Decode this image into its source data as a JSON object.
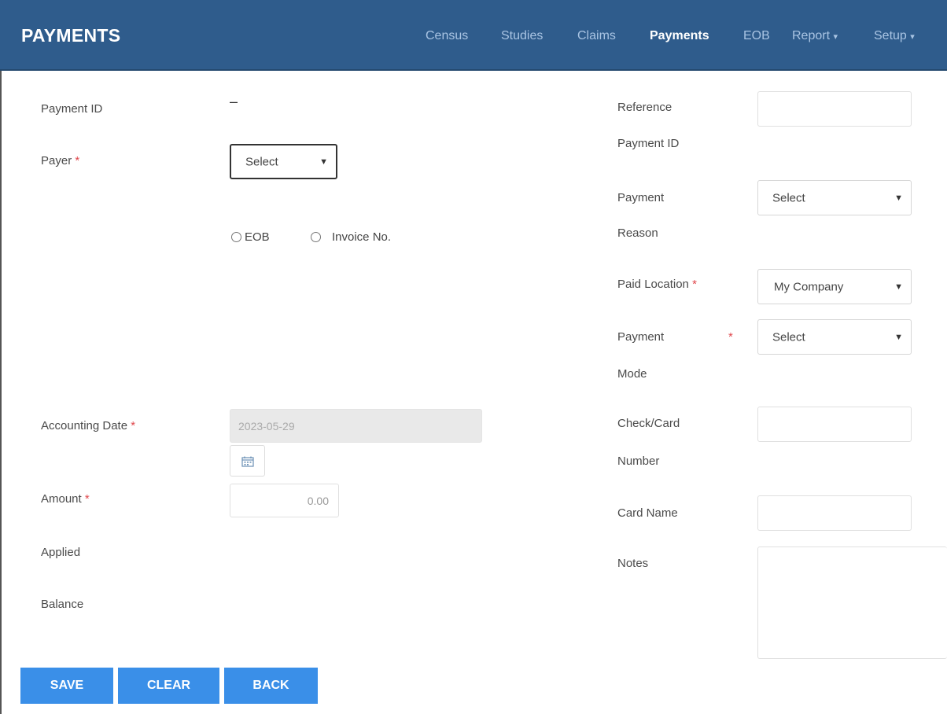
{
  "header": {
    "title": "PAYMENTS",
    "nav": [
      {
        "label": "Census",
        "active": false
      },
      {
        "label": "Studies",
        "active": false
      },
      {
        "label": "Claims",
        "active": false
      },
      {
        "label": "Payments",
        "active": true
      },
      {
        "label": "EOB",
        "active": false
      },
      {
        "label": "Report",
        "active": false,
        "dropdown": "▾"
      },
      {
        "label": "Setup",
        "active": false,
        "dropdown": "▾"
      }
    ]
  },
  "left": {
    "payment_id": {
      "label": "Payment ID",
      "value": "–"
    },
    "payer": {
      "label": "Payer",
      "required": "*",
      "selected": "Select"
    },
    "radios": {
      "eob": "EOB",
      "invoice": "Invoice No."
    },
    "accounting_date": {
      "label": "Accounting Date",
      "required": "*",
      "value": "2023-05-29"
    },
    "amount": {
      "label": "Amount",
      "required": "*",
      "value": "0.00"
    },
    "applied": {
      "label": "Applied"
    },
    "balance": {
      "label": "Balance"
    }
  },
  "right": {
    "reference": {
      "label_line1": "Reference",
      "label_line2": "Payment ID",
      "value": ""
    },
    "reason": {
      "label_line1": "Payment",
      "label_line2": "Reason",
      "selected": "Select"
    },
    "location": {
      "label": "Paid Location",
      "required": "*",
      "selected": "My Company"
    },
    "mode": {
      "label_line1": "Payment",
      "label_line2": "Mode",
      "required": "*",
      "selected": "Select"
    },
    "card_number": {
      "label_line1": "Check/Card",
      "label_line2": "Number",
      "value": ""
    },
    "card_name": {
      "label": "Card Name",
      "value": ""
    },
    "notes": {
      "label": "Notes",
      "value": ""
    }
  },
  "buttons": {
    "save": "SAVE",
    "clear": "CLEAR",
    "back": "BACK"
  },
  "colors": {
    "header": "#2f5c8c",
    "button": "#3a8fe8",
    "required": "#e0474c"
  },
  "icons": {
    "dropdown": "chevron-down-icon",
    "calendar": "calendar-icon"
  }
}
